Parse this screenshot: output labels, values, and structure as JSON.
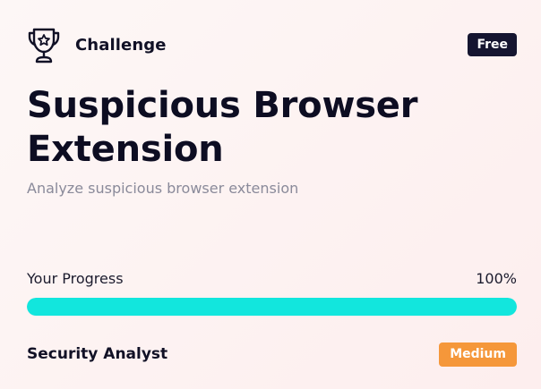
{
  "header": {
    "icon": "trophy-icon",
    "kicker": "Challenge",
    "badge": "Free"
  },
  "title": "Suspicious Browser Extension",
  "subtitle": "Analyze suspicious browser extension",
  "progress": {
    "label": "Your Progress",
    "value_text": "100%",
    "value": 100
  },
  "footer": {
    "role": "Security Analyst",
    "difficulty": "Medium"
  },
  "colors": {
    "badge_free_bg": "#151530",
    "progress_fill": "#12e6dd",
    "badge_medium_bg": "#f5973a",
    "title_text": "#0d0d22",
    "subtitle_text": "#8a8a9a"
  }
}
